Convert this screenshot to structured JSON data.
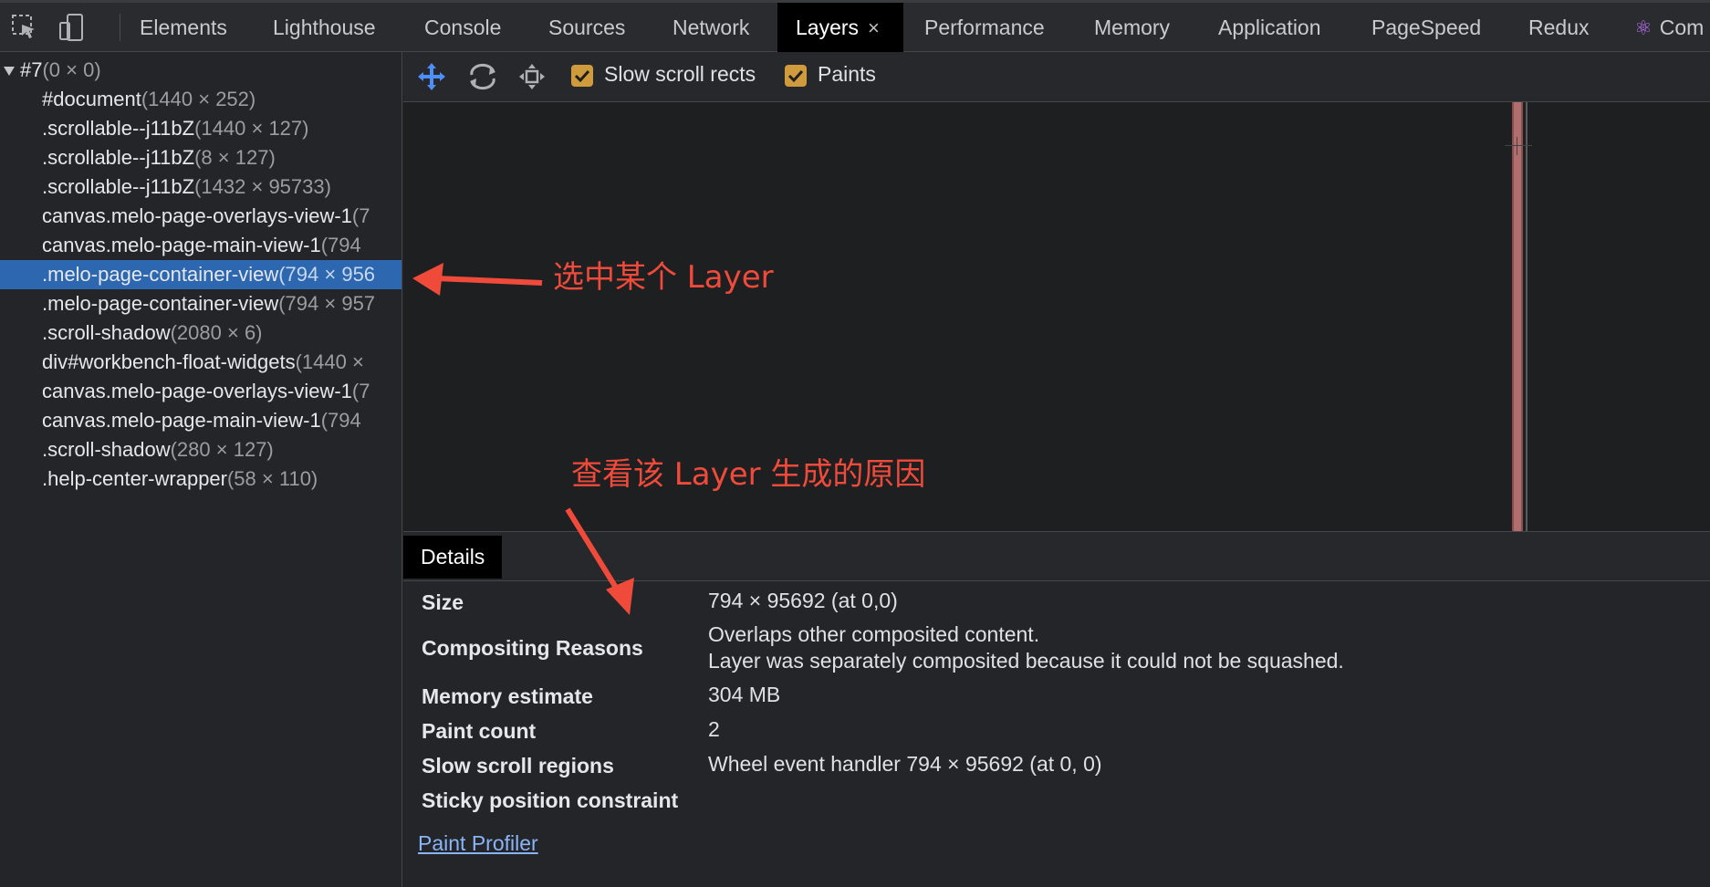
{
  "tabs": [
    {
      "label": "Elements",
      "active": false
    },
    {
      "label": "Lighthouse",
      "active": false
    },
    {
      "label": "Console",
      "active": false
    },
    {
      "label": "Sources",
      "active": false
    },
    {
      "label": "Network",
      "active": false
    },
    {
      "label": "Layers",
      "active": true,
      "close": "×"
    },
    {
      "label": "Performance",
      "active": false
    },
    {
      "label": "Memory",
      "active": false
    },
    {
      "label": "Application",
      "active": false
    },
    {
      "label": "PageSpeed",
      "active": false
    },
    {
      "label": "Redux",
      "active": false
    },
    {
      "label": "Com",
      "active": false,
      "icon": "react-icon"
    }
  ],
  "tree": [
    {
      "name": "#7",
      "dim": "(0 × 0)"
    },
    {
      "name": "#document",
      "dim": "(1440 × 252)"
    },
    {
      "name": ".scrollable--j11bZ",
      "dim": "(1440 × 127)"
    },
    {
      "name": ".scrollable--j11bZ",
      "dim": "(8 × 127)"
    },
    {
      "name": ".scrollable--j11bZ",
      "dim": "(1432 × 95733)"
    },
    {
      "name": "canvas.melo-page-overlays-view-1",
      "dim": "(7"
    },
    {
      "name": "canvas.melo-page-main-view-1",
      "dim": "(794"
    },
    {
      "name": ".melo-page-container-view",
      "dim": "(794 × 956"
    },
    {
      "name": ".melo-page-container-view",
      "dim": "(794 × 957"
    },
    {
      "name": ".scroll-shadow",
      "dim": "(2080 × 6)"
    },
    {
      "name": "div#workbench-float-widgets",
      "dim": "(1440 ×"
    },
    {
      "name": "canvas.melo-page-overlays-view-1",
      "dim": "(7"
    },
    {
      "name": "canvas.melo-page-main-view-1",
      "dim": "(794"
    },
    {
      "name": ".scroll-shadow",
      "dim": "(280 × 127)"
    },
    {
      "name": ".help-center-wrapper",
      "dim": "(58 × 110)"
    }
  ],
  "toolbar": {
    "slow_scroll_label": "Slow scroll rects",
    "paints_label": "Paints"
  },
  "details": {
    "tab_label": "Details",
    "rows": [
      {
        "label": "Size",
        "values": [
          "794 × 95692 (at 0,0)"
        ]
      },
      {
        "label": "Compositing Reasons",
        "values": [
          "Overlaps other composited content.",
          "Layer was separately composited because it could not be squashed."
        ]
      },
      {
        "label": "Memory estimate",
        "values": [
          "304 MB"
        ]
      },
      {
        "label": "Paint count",
        "values": [
          "2"
        ]
      },
      {
        "label": "Slow scroll regions",
        "values": [
          "Wheel event handler 794 × 95692 (at 0, 0)"
        ]
      },
      {
        "label": "Sticky position constraint",
        "values": []
      }
    ],
    "paint_profiler": "Paint Profiler"
  },
  "annotations": {
    "select_layer": "选中某个 Layer",
    "view_reason": "查看该 Layer 生成的原因"
  },
  "colors": {
    "accent_selected": "#2c67b0",
    "checkbox": "#d09b3c",
    "annotation_red": "#f04a3b",
    "link": "#8ab4f8"
  }
}
